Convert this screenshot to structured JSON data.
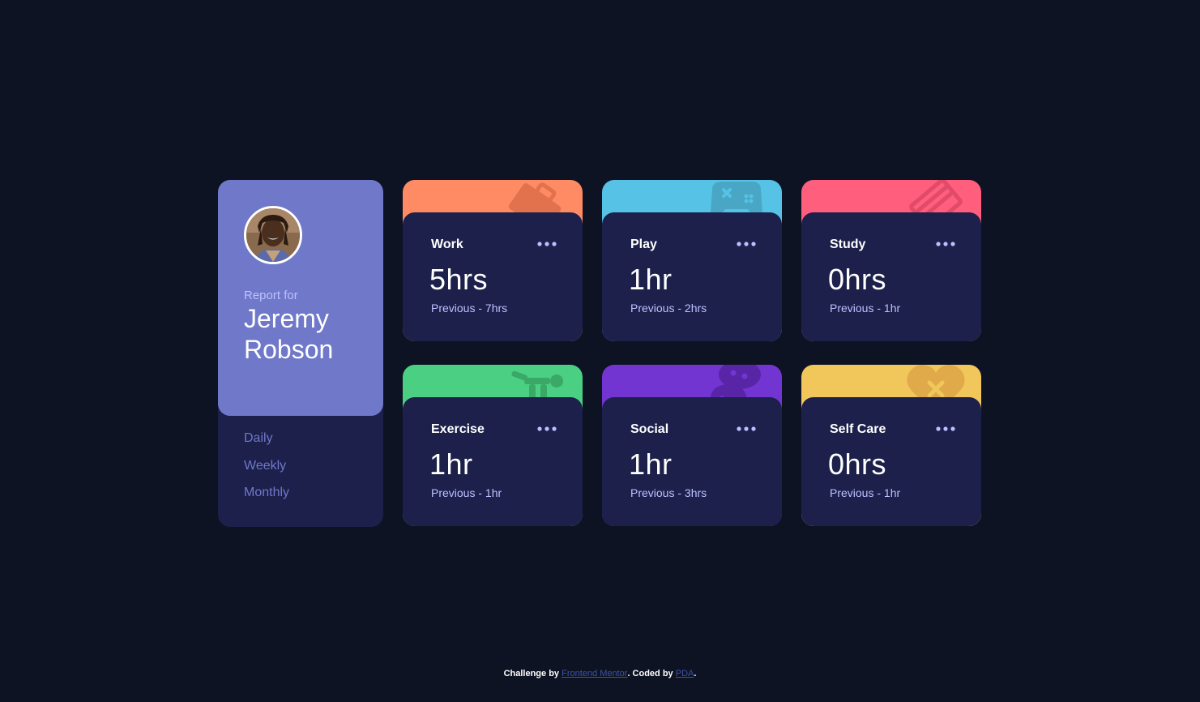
{
  "profile": {
    "report_for": "Report for",
    "name": "Jeremy Robson",
    "periods": [
      "Daily",
      "Weekly",
      "Monthly"
    ]
  },
  "cards": [
    {
      "title": "Work",
      "hours": "5hrs",
      "previous": "Previous - 7hrs",
      "color": "#ff8b64",
      "icon": "briefcase-icon"
    },
    {
      "title": "Play",
      "hours": "1hr",
      "previous": "Previous - 2hrs",
      "color": "#55c2e6",
      "icon": "gamepad-icon"
    },
    {
      "title": "Study",
      "hours": "0hrs",
      "previous": "Previous - 1hr",
      "color": "#ff5e7d",
      "icon": "book-icon"
    },
    {
      "title": "Exercise",
      "hours": "1hr",
      "previous": "Previous - 1hr",
      "color": "#4bcf82",
      "icon": "running-figure-icon"
    },
    {
      "title": "Social",
      "hours": "1hr",
      "previous": "Previous - 3hrs",
      "color": "#7335d2",
      "icon": "chat-bubbles-icon"
    },
    {
      "title": "Self Care",
      "hours": "0hrs",
      "previous": "Previous - 1hr",
      "color": "#f1c75b",
      "icon": "heart-icon"
    }
  ],
  "footer": {
    "challenge_by": "Challenge by",
    "frontend_mentor": "Frontend Mentor",
    "coded_by": ". Coded by",
    "author": "PDA",
    "end": "."
  }
}
